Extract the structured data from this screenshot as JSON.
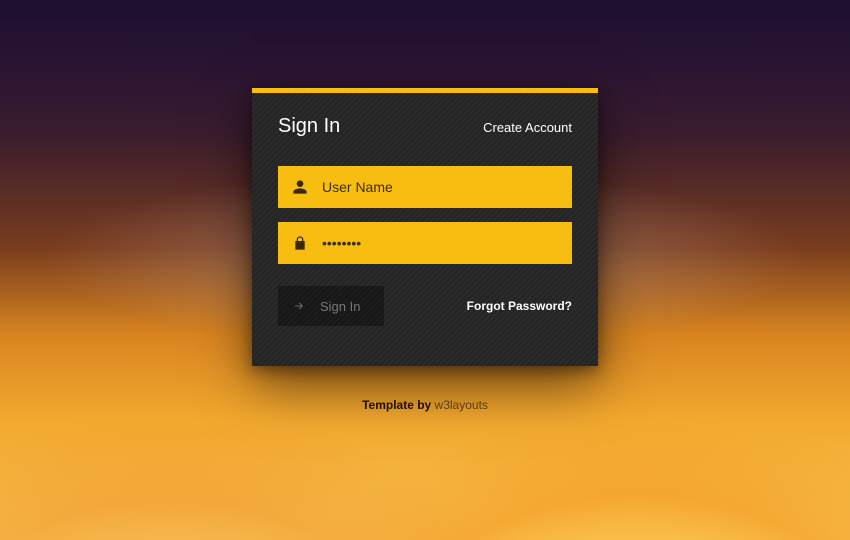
{
  "header": {
    "title": "Sign In",
    "create_account": "Create Account"
  },
  "form": {
    "username_placeholder": "User Name",
    "username_value": "",
    "password_placeholder": "••••••••",
    "password_value": ""
  },
  "actions": {
    "signin_label": "Sign In",
    "forgot_label": "Forgot Password?"
  },
  "footer": {
    "prefix": "Template by ",
    "brand": "w3layouts"
  }
}
